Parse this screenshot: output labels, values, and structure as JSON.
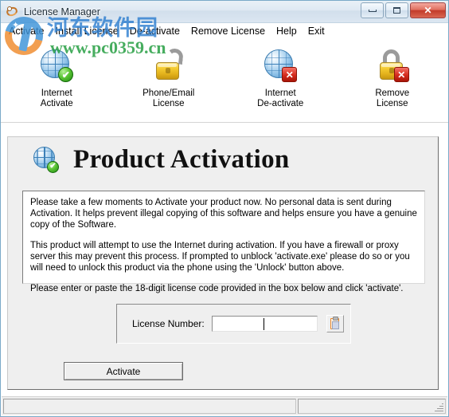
{
  "window": {
    "title": "License Manager",
    "icon": "app-icon",
    "buttons": {
      "minimize": "minimize",
      "maximize": "maximize",
      "close": "✕"
    }
  },
  "menu": {
    "items": [
      {
        "label": "Activate"
      },
      {
        "label": "Install License"
      },
      {
        "label": "De-activate"
      },
      {
        "label": "Remove License"
      },
      {
        "label": "Help"
      },
      {
        "label": "Exit"
      }
    ]
  },
  "toolbar": {
    "items": [
      {
        "label": "Internet\nActivate",
        "icon": "globe-check-icon",
        "badge": "✔"
      },
      {
        "label": "Phone/Email\nLicense",
        "icon": "padlock-open-icon",
        "badge": ""
      },
      {
        "label": "Internet\nDe-activate",
        "icon": "globe-x-icon",
        "badge": "✕"
      },
      {
        "label": "Remove\nLicense",
        "icon": "padlock-x-icon",
        "badge": "✕"
      }
    ]
  },
  "main": {
    "header": {
      "title": "Product Activation",
      "icon": "globe-check-icon",
      "badge": "✔"
    },
    "instructions": [
      "Please take a few moments to Activate your product now.  No personal data is sent during Activation.  It helps prevent illegal copying of this software and helps ensure you have a genuine copy of the Software.",
      "This product will attempt to use the Internet during activation.  If you have a firewall or proxy server this may prevent this process.  If prompted to unblock 'activate.exe' please do so or you will need to unlock this product via the phone using the 'Unlock' button above.",
      "Please enter or paste the 18-digit license code provided in the box below and click 'activate'."
    ],
    "license": {
      "label": "License Number:",
      "value": "",
      "placeholder": "",
      "paste_icon": "clipboard-paste-icon"
    },
    "activate_button": "Activate"
  },
  "statusbar": {
    "left": "",
    "right": "",
    "grip": "resize-grip"
  },
  "watermark": {
    "site_cn": "河东软件园",
    "url": "www.pc0359.cn",
    "logo": "hedong-logo"
  },
  "colors": {
    "title_gradient_top": "#e9f1f7",
    "close_button": "#c23b2a",
    "panel_bg": "#efefef",
    "textbox_bg": "#ffffff",
    "globe_blue": "#4e90c6",
    "padlock_yellow": "#f5cc33",
    "badge_green": "#1f8a10",
    "badge_red": "#d52b1e",
    "watermark_blue": "#2f7fd0",
    "watermark_green": "#1f9c3c",
    "watermark_orange": "#f08a2c"
  }
}
